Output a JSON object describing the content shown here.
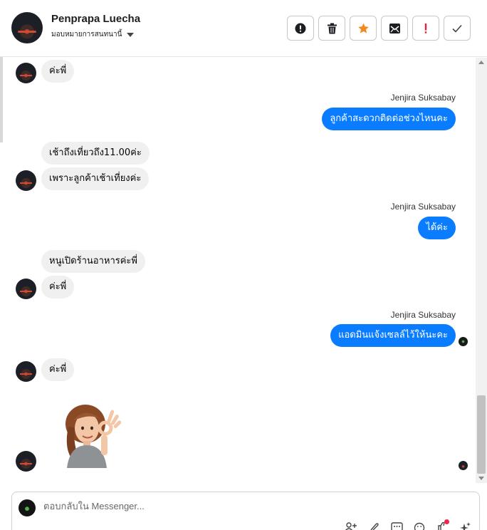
{
  "header": {
    "contact_name": "Penprapa Luecha",
    "assign_label": "มอบหมายการสนทนานี้",
    "actions": [
      {
        "name": "report-icon",
        "label": "รายงาน"
      },
      {
        "name": "trash-icon",
        "label": "ลบ"
      },
      {
        "name": "star-icon",
        "label": "ติดดาว"
      },
      {
        "name": "mark-unread-icon",
        "label": "ทำเครื่องหมายว่ายังไม่ได้อ่าน"
      },
      {
        "name": "important-icon",
        "label": "สำคัญ"
      },
      {
        "name": "done-icon",
        "label": "เสร็จแล้ว"
      }
    ]
  },
  "messages": {
    "m1": "ค่ะพี่",
    "s1": "Jenjira Suksabay",
    "m2": "ลูกค้าสะดวกติดต่อช่วงไหนคะ",
    "m3": "เช้าถึงเที่ยวถึง11.00ค่ะ",
    "m4": "เพราะลูกค้าเช้าเที่ยงค่ะ",
    "s2": "Jenjira Suksabay",
    "m5": "ได้ค่ะ",
    "m6": "หนูเปิดร้านอาหารค่ะพี่",
    "m7": "ค่ะพี่",
    "s3": "Jenjira Suksabay",
    "m8": "แอดมินแจ้งเซลล์ไว้ให้นะคะ",
    "m9": "ค่ะพี่"
  },
  "composer": {
    "placeholder": "ตอบกลับใน Messenger..."
  },
  "colors": {
    "outgoing_bubble": "#0a7cff",
    "incoming_bubble": "#f0f0f0",
    "star": "#f28a1e",
    "important": "#e41e3f"
  }
}
